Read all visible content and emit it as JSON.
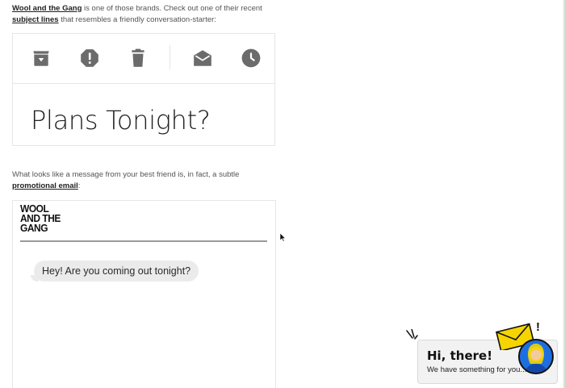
{
  "article": {
    "para1": {
      "link1": "Wool and the Gang",
      "text1": " is one of those brands. Check out one of their recent ",
      "link2": "subject lines",
      "text2": " that resembles a friendly conversation-starter:"
    },
    "para2": {
      "text1": "What looks like a message from your best friend is, in fact, a subtle ",
      "link": "promotional email",
      "text2": ":"
    }
  },
  "inbox_mock": {
    "icons": [
      "archive-icon",
      "report-spam-icon",
      "delete-icon",
      "mark-unread-icon",
      "snooze-icon"
    ],
    "subject": "Plans Tonight?"
  },
  "email_preview": {
    "logo_lines": [
      "WOOL",
      "AND THE",
      "GANG"
    ],
    "bubble_text": "Hey! Are you coming out tonight?"
  },
  "chat_widget": {
    "title": "Hi, there!",
    "subtitle": "We have something for you...",
    "exclamation": "!",
    "accent": "#f5d400",
    "avatar_color": "#1d6fe0"
  },
  "colors": {
    "icon_gray": "#6b6b6b",
    "right_edge": "#cfe9d2"
  }
}
